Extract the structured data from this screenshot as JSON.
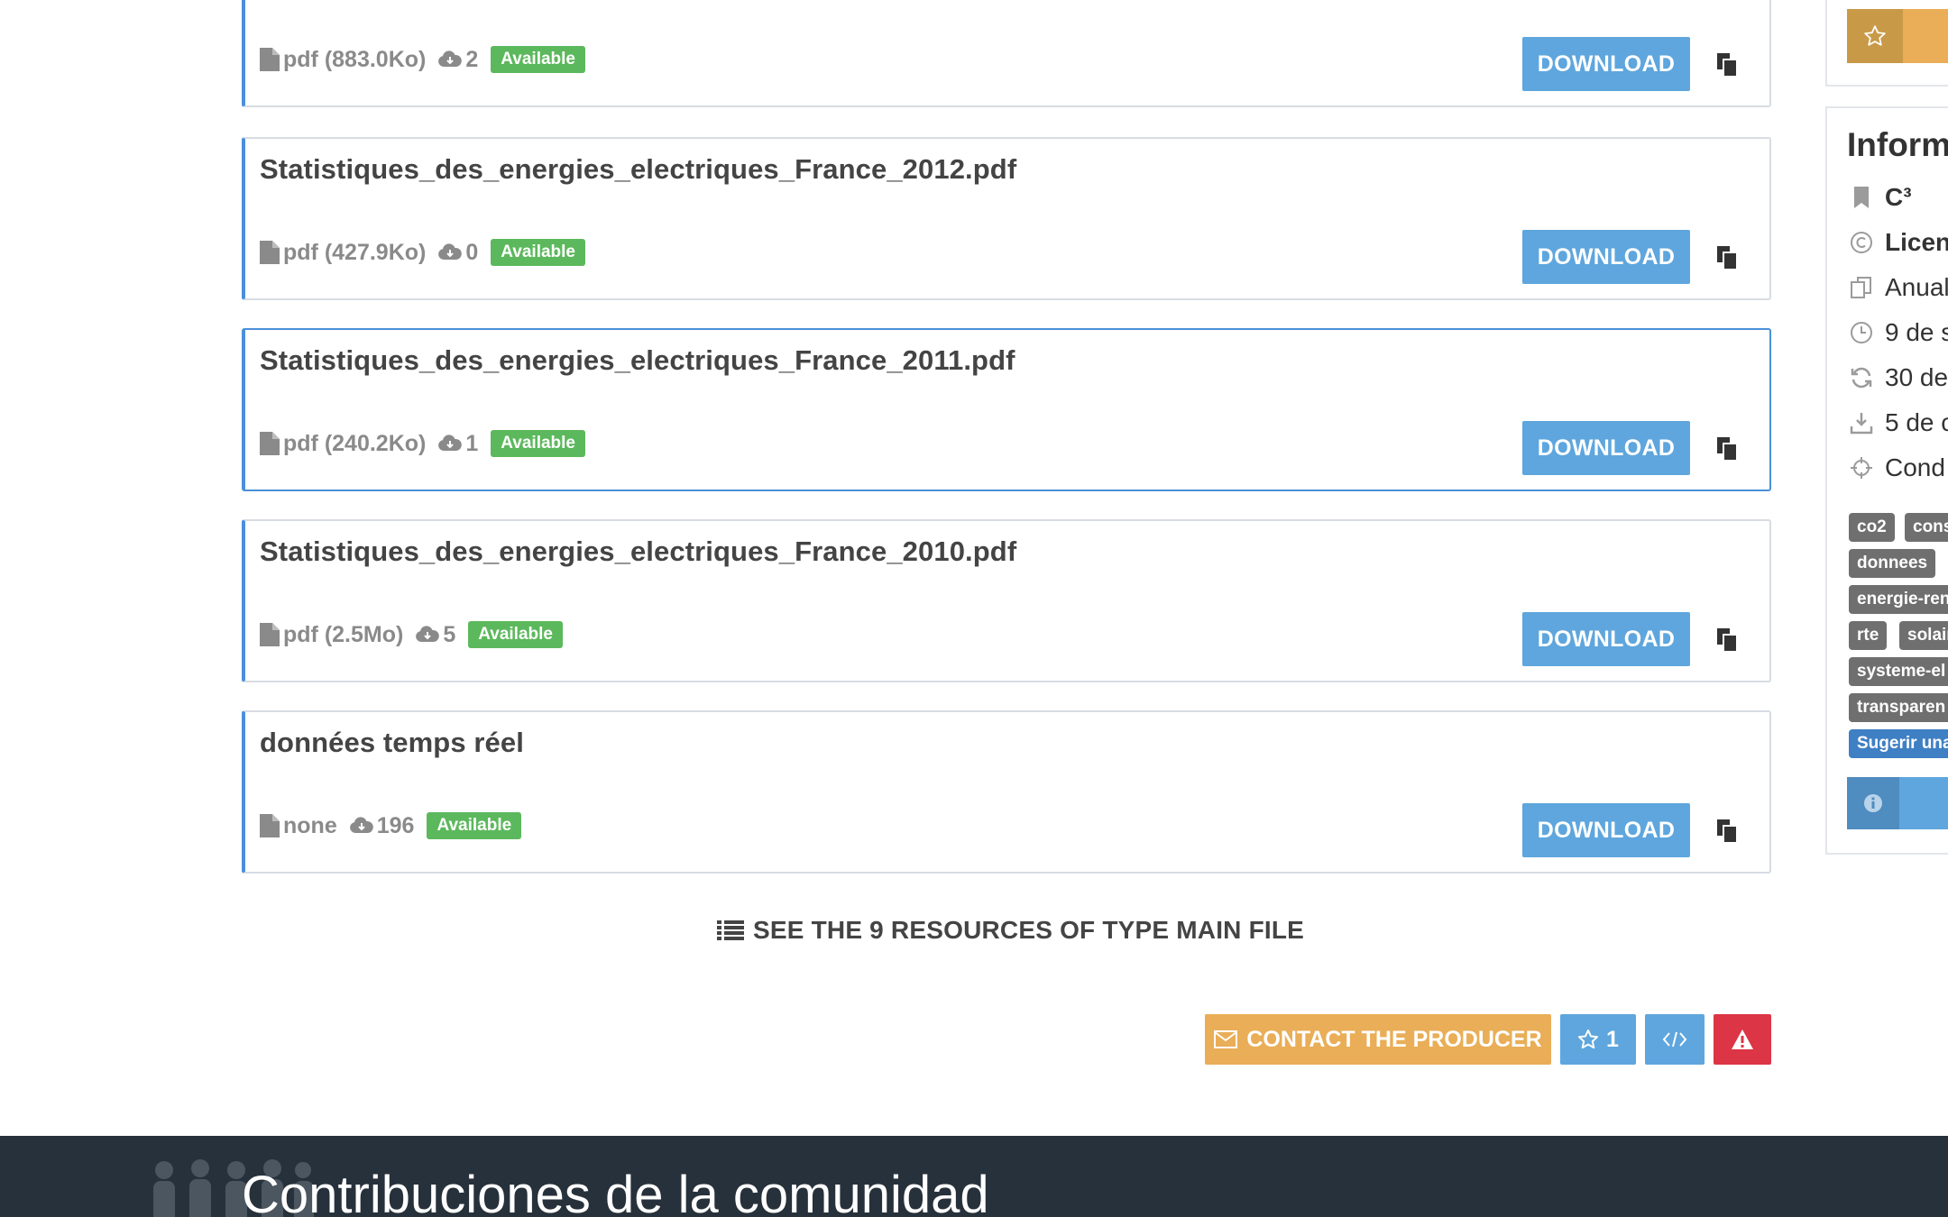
{
  "resources": [
    {
      "title": "",
      "format": "pdf (883.0Ko)",
      "downloads": "2",
      "status": "Available",
      "action": "DOWNLOAD"
    },
    {
      "title": "Statistiques_des_energies_electriques_France_2012.pdf",
      "format": "pdf (427.9Ko)",
      "downloads": "0",
      "status": "Available",
      "action": "DOWNLOAD"
    },
    {
      "title": "Statistiques_des_energies_electriques_France_2011.pdf",
      "format": "pdf (240.2Ko)",
      "downloads": "1",
      "status": "Available",
      "action": "DOWNLOAD"
    },
    {
      "title": "Statistiques_des_energies_electriques_France_2010.pdf",
      "format": "pdf (2.5Mo)",
      "downloads": "5",
      "status": "Available",
      "action": "DOWNLOAD"
    },
    {
      "title": "données temps réel",
      "format": "none",
      "downloads": "196",
      "status": "Available",
      "action": "DOWNLOAD"
    }
  ],
  "see_all_label": "SEE THE 9 RESOURCES OF TYPE MAIN FILE",
  "actions": {
    "contact_label": "CONTACT THE PRODUCER",
    "star_count": "1"
  },
  "community": {
    "title": "Contribuciones de la comunidad"
  },
  "sidebar": {
    "heading": "Inform",
    "rows": [
      {
        "icon": "bookmark-icon",
        "text": "C³",
        "bold": true
      },
      {
        "icon": "copyright-icon",
        "text": "Licen",
        "bold": true
      },
      {
        "icon": "copy-icon",
        "text": "Anual"
      },
      {
        "icon": "clock-icon",
        "text": "9 de s"
      },
      {
        "icon": "refresh-icon",
        "text": "30 de"
      },
      {
        "icon": "download-tray-icon",
        "text": "5 de c"
      },
      {
        "icon": "crosshair-icon",
        "text": "Cond"
      }
    ],
    "tags": [
      "co2",
      "cons",
      "donnees",
      "energie-ren",
      "rte",
      "solaire",
      "systeme-el",
      "transparen",
      "Sugerir una"
    ]
  },
  "colors": {
    "primary": "#5ea6dd",
    "accent_orange": "#e9ae57",
    "success": "#5cb85c",
    "danger": "#dc3545",
    "footer_bg": "#27313b"
  }
}
